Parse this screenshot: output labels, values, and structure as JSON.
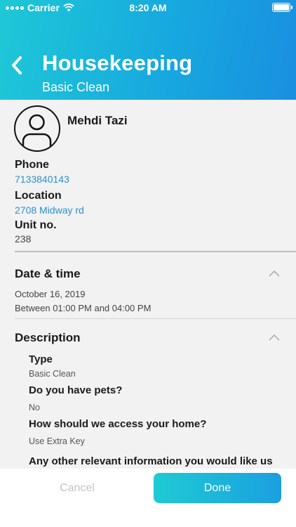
{
  "status_bar": {
    "carrier": "Carrier",
    "time": "8:20 AM"
  },
  "header": {
    "title": "Housekeeping",
    "subtitle": "Basic Clean"
  },
  "customer": {
    "name": "Mehdi Tazi",
    "phone_label": "Phone",
    "phone": "7133840143",
    "location_label": "Location",
    "location": "2708 Midway rd",
    "unit_label": "Unit no.",
    "unit": "238"
  },
  "datetime": {
    "title": "Date & time",
    "date": "October 16, 2019",
    "window": "Between 01:00 PM and 04:00 PM"
  },
  "description": {
    "title": "Description",
    "items": [
      {
        "label": "Type",
        "value": "Basic Clean"
      },
      {
        "label": "Do you have pets?",
        "value": "No"
      },
      {
        "label": "How should we access your home?",
        "value": "Use Extra Key"
      },
      {
        "label": "Any other relevant information you would like us",
        "value": ""
      }
    ]
  },
  "footer": {
    "cancel_label": "Cancel",
    "done_label": "Done"
  }
}
